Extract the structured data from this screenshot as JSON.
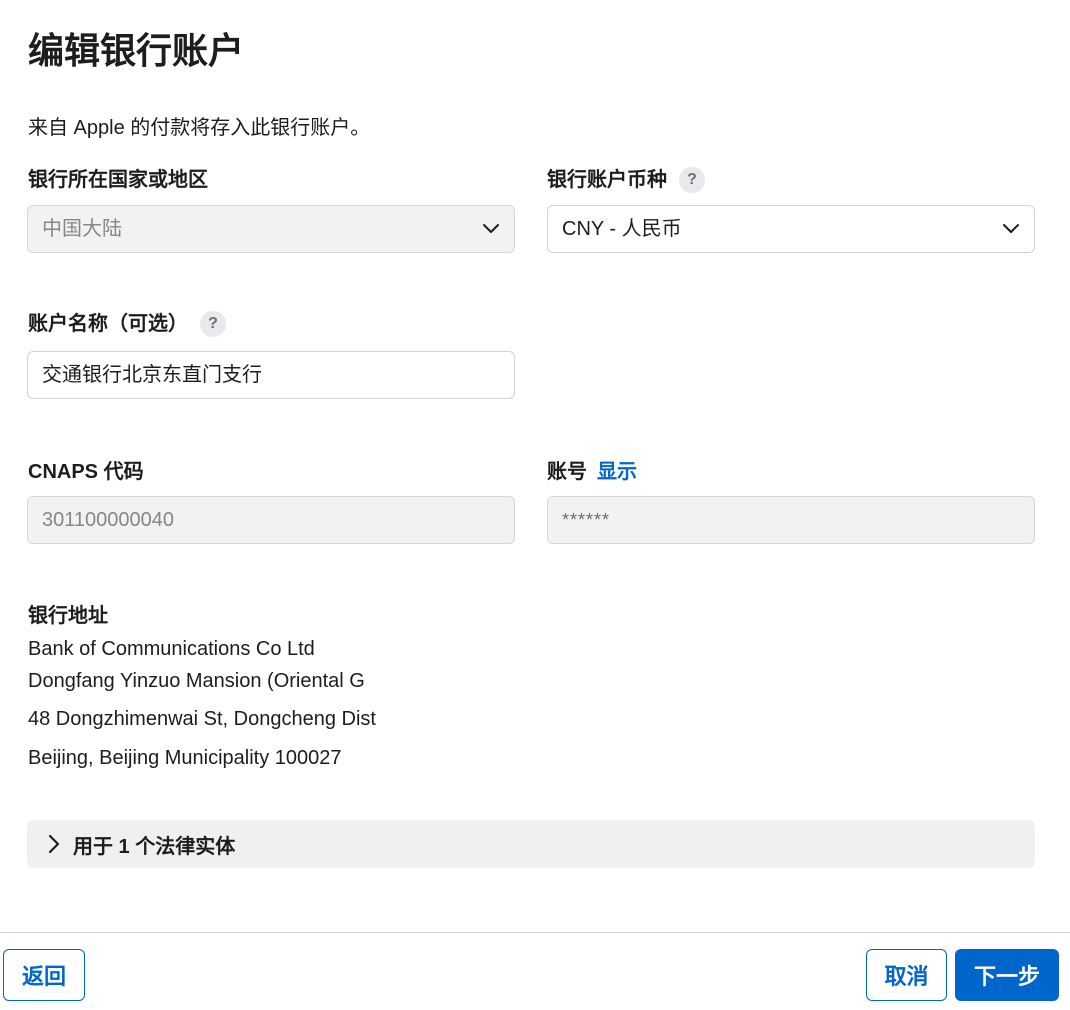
{
  "page": {
    "title": "编辑银行账户",
    "intro": "来自 Apple 的付款将存入此银行账户。"
  },
  "bank_country": {
    "label": "银行所在国家或地区",
    "value": "中国大陆",
    "disabled": true
  },
  "currency": {
    "label": "银行账户币种",
    "help": "?",
    "value": "CNY - 人民币"
  },
  "account_name": {
    "label": "账户名称（可选）",
    "help": "?",
    "value": "交通银行北京东直门支行"
  },
  "cnaps": {
    "label": "CNAPS 代码",
    "value": "301100000040",
    "disabled": true
  },
  "account_number": {
    "label": "账号",
    "show_link": "显示",
    "value": "******",
    "disabled": true
  },
  "bank_address": {
    "title": "银行地址",
    "lines": [
      "Bank of Communications Co Ltd",
      "Dongfang Yinzuo Mansion (Oriental G",
      "48 Dongzhimenwai St, Dongcheng Dist",
      "Beijing, Beijing Municipality 100027"
    ]
  },
  "legal_entities": {
    "label": "用于 1 个法律实体",
    "icon": "chevron-right-icon"
  },
  "footer": {
    "back_label": "返回",
    "cancel_label": "取消",
    "next_label": "下一步"
  },
  "colors": {
    "accent": "#0066cc",
    "disabled_field": "#f2f2f2",
    "disclosure_bg": "#f0f0f0"
  }
}
